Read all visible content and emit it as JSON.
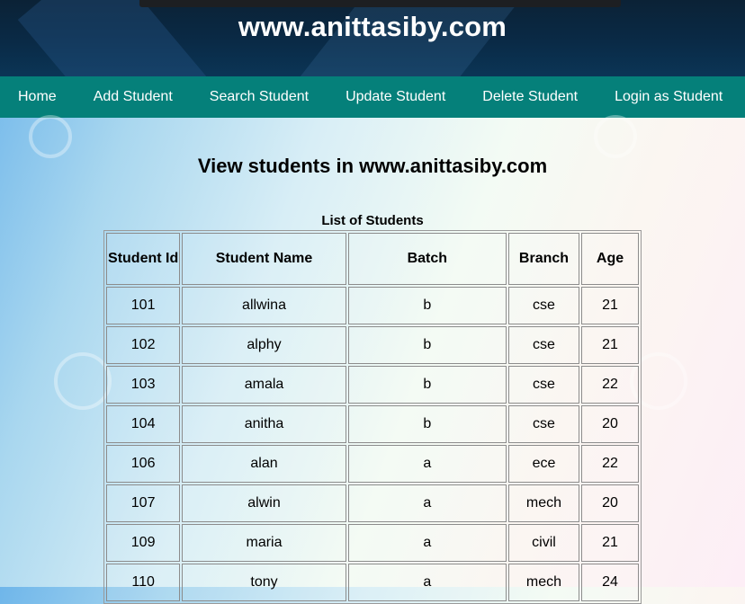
{
  "site": {
    "title": "www.anittasiby.com"
  },
  "nav": [
    {
      "label": "Home"
    },
    {
      "label": "Add Student"
    },
    {
      "label": "Search Student"
    },
    {
      "label": "Update Student"
    },
    {
      "label": "Delete Student"
    },
    {
      "label": "Login as Student"
    }
  ],
  "main": {
    "heading": "View students in www.anittasiby.com",
    "table_caption": "List of Students",
    "columns": [
      "Student Id",
      "Student Name",
      "Batch",
      "Branch",
      "Age"
    ],
    "rows": [
      [
        "101",
        "allwina",
        "b",
        "cse",
        "21"
      ],
      [
        "102",
        "alphy",
        "b",
        "cse",
        "21"
      ],
      [
        "103",
        "amala",
        "b",
        "cse",
        "22"
      ],
      [
        "104",
        "anitha",
        "b",
        "cse",
        "20"
      ],
      [
        "106",
        "alan",
        "a",
        "ece",
        "22"
      ],
      [
        "107",
        "alwin",
        "a",
        "mech",
        "20"
      ],
      [
        "109",
        "maria",
        "a",
        "civil",
        "21"
      ],
      [
        "110",
        "tony",
        "a",
        "mech",
        "24"
      ]
    ]
  },
  "colors": {
    "header_bg": "#0a2a46",
    "nav_bg": "#05807a",
    "nav_text": "#ffffff"
  }
}
